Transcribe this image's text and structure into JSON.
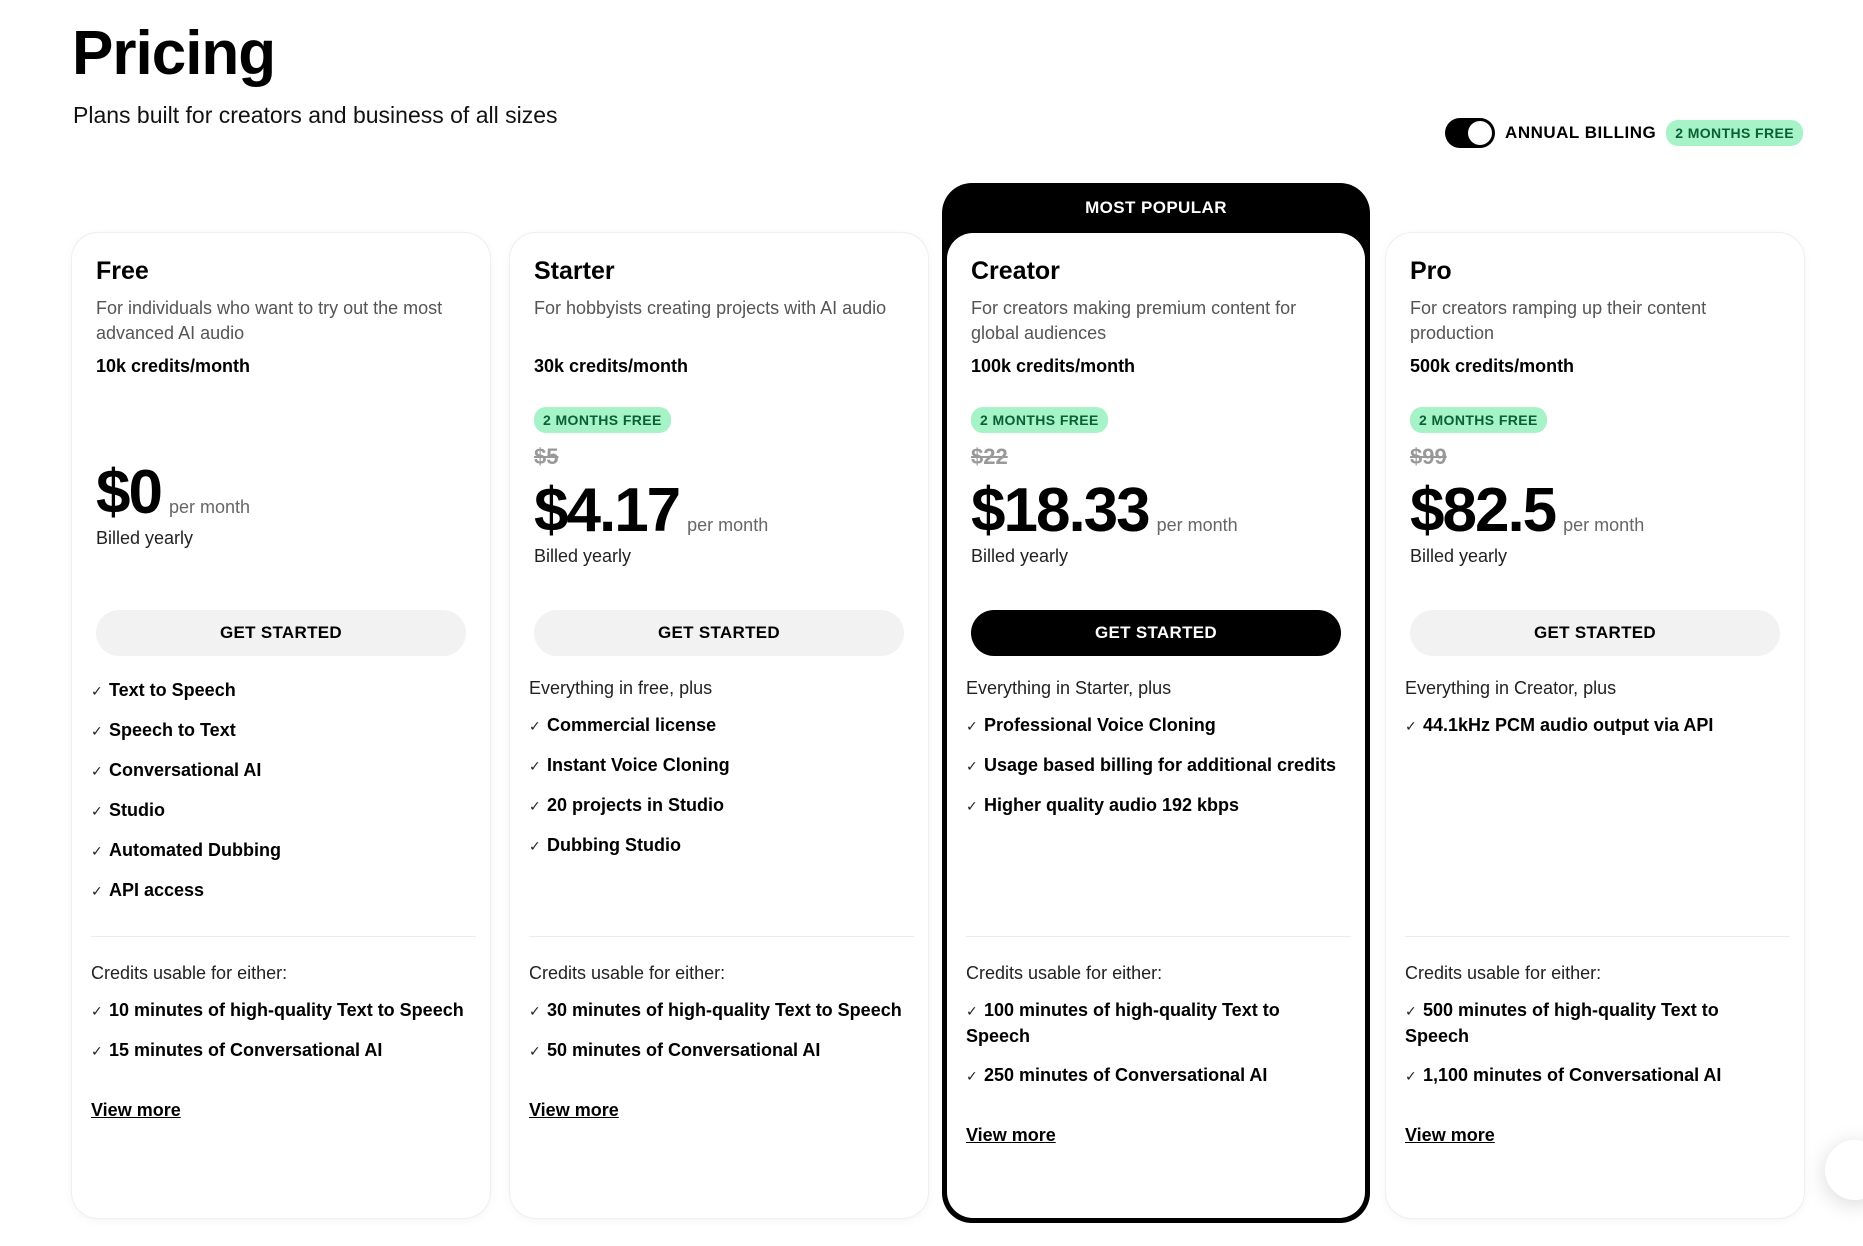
{
  "header": {
    "title": "Pricing",
    "subtitle": "Plans built for creators and business of all sizes"
  },
  "billing": {
    "label": "ANNUAL BILLING",
    "badge": "2 MONTHS FREE",
    "annual_enabled": true
  },
  "colors": {
    "badge_bg": "#a5f3c7",
    "badge_text": "#0b5f34",
    "featured_border": "#000000",
    "button_default": "#f2f2f2",
    "button_featured": "#000000"
  },
  "plans": [
    {
      "name": "Free",
      "description": "For individuals who want to try out the most advanced AI audio",
      "credits": "10k credits/month",
      "badge": "",
      "old_price": "",
      "price": "$0",
      "per": "per month",
      "billed": "Billed yearly",
      "cta": "GET STARTED",
      "features_intro": "",
      "features": [
        "Text to Speech",
        "Speech to Text",
        "Conversational AI",
        "Studio",
        "Automated Dubbing",
        "API access"
      ],
      "credits_title": "Credits usable for either:",
      "credit_items": [
        "10 minutes of high-quality Text to Speech",
        "15 minutes of Conversational AI"
      ],
      "view_more": "View more"
    },
    {
      "name": "Starter",
      "description": "For hobbyists creating projects with AI audio",
      "credits": "30k credits/month",
      "badge": "2 MONTHS FREE",
      "old_price": "$5",
      "price": "$4.17",
      "per": "per month",
      "billed": "Billed yearly",
      "cta": "GET STARTED",
      "features_intro": "Everything in free, plus",
      "features": [
        "Commercial license",
        "Instant Voice Cloning",
        "20 projects in Studio",
        "Dubbing Studio"
      ],
      "credits_title": "Credits usable for either:",
      "credit_items": [
        "30 minutes of high-quality Text to Speech",
        "50 minutes of Conversational AI"
      ],
      "view_more": "View more"
    },
    {
      "name": "Creator",
      "popular_label": "MOST POPULAR",
      "description": "For creators making premium content for global audiences",
      "credits": "100k credits/month",
      "badge": "2 MONTHS FREE",
      "old_price": "$22",
      "price": "$18.33",
      "per": "per month",
      "billed": "Billed yearly",
      "cta": "GET STARTED",
      "features_intro": "Everything in Starter, plus",
      "features": [
        "Professional Voice Cloning",
        "Usage based billing for additional credits",
        "Higher quality audio 192 kbps"
      ],
      "credits_title": "Credits usable for either:",
      "credit_items": [
        "100 minutes of high-quality Text to Speech",
        "250 minutes of Conversational AI"
      ],
      "view_more": "View more"
    },
    {
      "name": "Pro",
      "description": "For creators ramping up their content production",
      "credits": "500k credits/month",
      "badge": "2 MONTHS FREE",
      "old_price": "$99",
      "price": "$82.5",
      "per": "per month",
      "billed": "Billed yearly",
      "cta": "GET STARTED",
      "features_intro": "Everything in Creator, plus",
      "features": [
        "44.1kHz PCM audio output via API"
      ],
      "credits_title": "Credits usable for either:",
      "credit_items": [
        "500 minutes of high-quality Text to Speech",
        "1,100 minutes of Conversational AI"
      ],
      "view_more": "View more"
    }
  ]
}
